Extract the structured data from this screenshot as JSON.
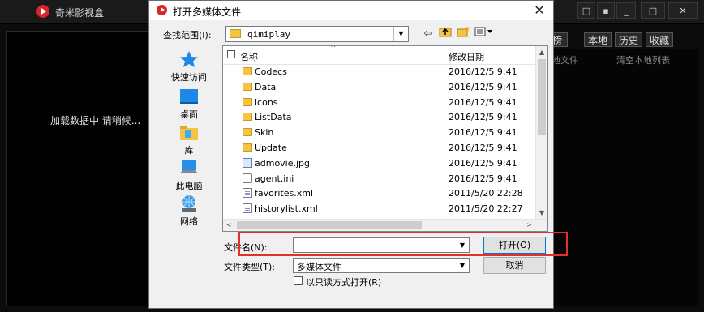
{
  "player": {
    "title": "奇米影视盒",
    "controls": [
      "□",
      "▪",
      "_",
      "□",
      "✕"
    ],
    "loading": "加载数据中 请稍候...",
    "tabs": [
      "榜",
      "本地",
      "历史",
      "收藏"
    ],
    "sub_local": "地文件",
    "sub_clear": "清空本地列表"
  },
  "dialog": {
    "title": "打开多媒体文件",
    "close": "✕",
    "lookin_label": "查找范围(I):",
    "lookin_value": "qimiplay",
    "places": [
      {
        "label": "快速访问",
        "icon": "star-icon"
      },
      {
        "label": "桌面",
        "icon": "desktop-icon"
      },
      {
        "label": "库",
        "icon": "library-icon"
      },
      {
        "label": "此电脑",
        "icon": "computer-icon"
      },
      {
        "label": "网络",
        "icon": "network-icon"
      }
    ],
    "columns": {
      "name": "名称",
      "date": "修改日期"
    },
    "files": [
      {
        "name": "Codecs",
        "date": "2016/12/5 9:41",
        "type": "folder"
      },
      {
        "name": "Data",
        "date": "2016/12/5 9:41",
        "type": "folder"
      },
      {
        "name": "icons",
        "date": "2016/12/5 9:41",
        "type": "folder"
      },
      {
        "name": "ListData",
        "date": "2016/12/5 9:41",
        "type": "folder"
      },
      {
        "name": "Skin",
        "date": "2016/12/5 9:41",
        "type": "folder"
      },
      {
        "name": "Update",
        "date": "2016/12/5 9:41",
        "type": "folder"
      },
      {
        "name": "admovie.jpg",
        "date": "2016/12/5 9:41",
        "type": "image"
      },
      {
        "name": "agent.ini",
        "date": "2016/12/5 9:41",
        "type": "gear"
      },
      {
        "name": "favorites.xml",
        "date": "2011/5/20 22:28",
        "type": "file"
      },
      {
        "name": "historylist.xml",
        "date": "2011/5/20 22:27",
        "type": "file"
      }
    ],
    "filename_label": "文件名(N):",
    "filename_value": "",
    "filetype_label": "文件类型(T):",
    "filetype_value": "多媒体文件",
    "open_button": "打开(O)",
    "cancel_button": "取消",
    "readonly_label": "以只读方式打开(R)",
    "readonly_checked": false,
    "highlight_color": "#e0312d"
  }
}
